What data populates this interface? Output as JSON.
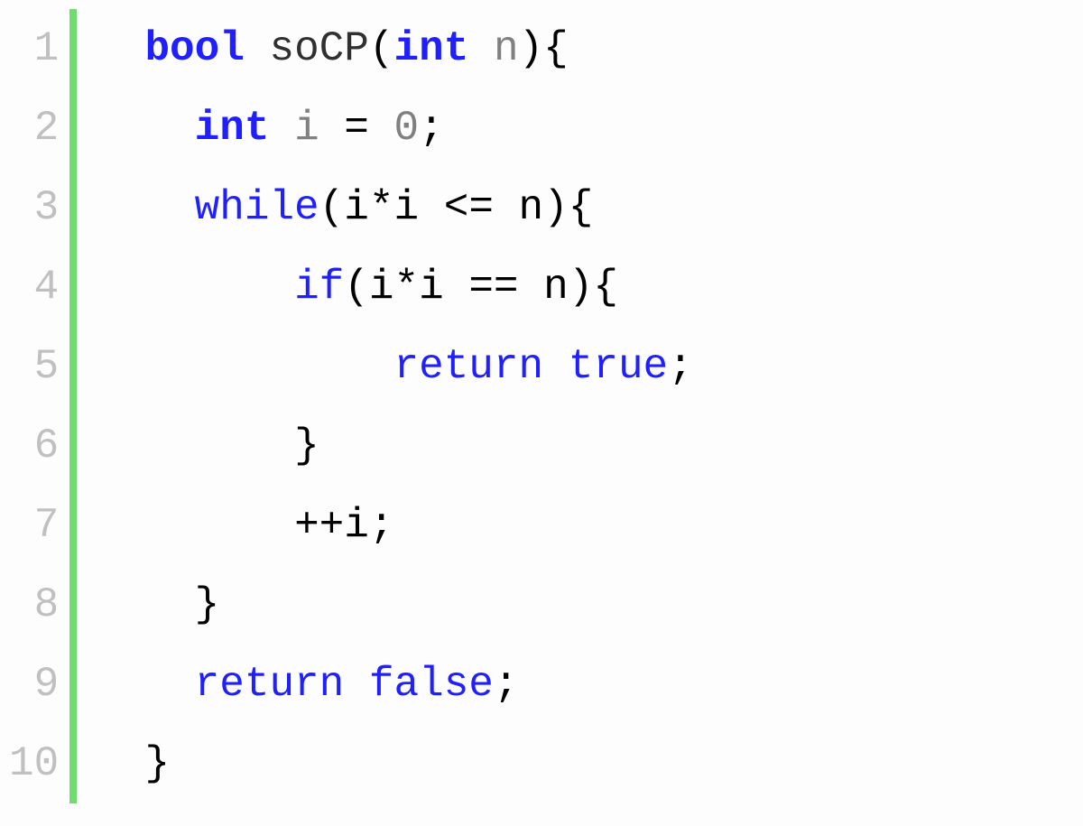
{
  "lineNumbers": [
    "1",
    "2",
    "3",
    "4",
    "5",
    "6",
    "7",
    "8",
    "9",
    "10"
  ],
  "code": {
    "l1": {
      "indent": "  ",
      "bool": "bool",
      "sp1": " ",
      "fn": "soCP",
      "lp": "(",
      "int": "int",
      "sp2": " ",
      "n": "n",
      "rp": ")",
      "lb": "{"
    },
    "l2": {
      "indent": "    ",
      "int": "int",
      "sp1": " ",
      "i": "i",
      "sp2": " ",
      "eq": "=",
      "sp3": " ",
      "zero": "0",
      "semi": ";"
    },
    "l3": {
      "indent": "    ",
      "while": "while",
      "lp": "(",
      "i1": "i",
      "star": "*",
      "i2": "i",
      "sp1": " ",
      "le": "<=",
      "sp2": " ",
      "n": "n",
      "rp": ")",
      "lb": "{"
    },
    "l4": {
      "indent": "        ",
      "if": "if",
      "lp": "(",
      "i1": "i",
      "star": "*",
      "i2": "i",
      "sp1": " ",
      "eqeq": "==",
      "sp2": " ",
      "n": "n",
      "rp": ")",
      "lb": "{"
    },
    "l5": {
      "indent": "            ",
      "return": "return",
      "sp": " ",
      "true": "true",
      "semi": ";"
    },
    "l6": {
      "indent": "        ",
      "rb": "}"
    },
    "l7": {
      "indent": "        ",
      "pp": "++",
      "i": "i",
      "semi": ";"
    },
    "l8": {
      "indent": "    ",
      "rb": "}"
    },
    "l9": {
      "indent": "    ",
      "return": "return",
      "sp": " ",
      "false": "false",
      "semi": ";"
    },
    "l10": {
      "indent": "  ",
      "rb": "}"
    }
  }
}
